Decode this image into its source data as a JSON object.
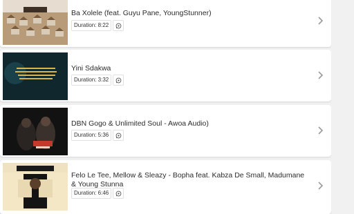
{
  "items": [
    {
      "title": "Ba Xolele (feat. Guyu Pane, YoungStunner)",
      "duration": "Duration: 8:22"
    },
    {
      "title": "Yini Sdakwa",
      "duration": "Duration: 3:32"
    },
    {
      "title": "DBN Gogo & Unlimited Soul - Awoa Audio)",
      "duration": "Duration: 5:36"
    },
    {
      "title": "Felo Le Tee, Mellow & Sleazy - Bopha feat. Kabza De Small, Madumane & Young Stunna",
      "duration": "Duration: 6:46"
    }
  ],
  "icons": {
    "share": "whatsapp-icon",
    "navigate": "chevron-right-icon"
  },
  "colors": {
    "card": "#ffffff",
    "background": "#f1f1f1",
    "text": "#2b2b2b"
  }
}
